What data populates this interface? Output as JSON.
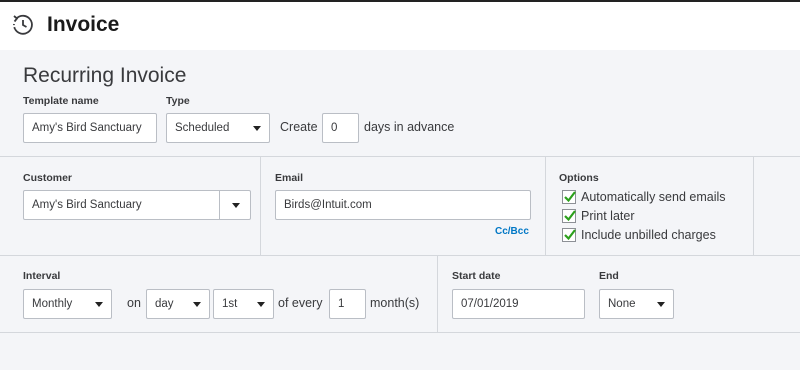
{
  "header": {
    "title": "Invoice",
    "icon": "recurring-icon"
  },
  "section_title": "Recurring Invoice",
  "template": {
    "name_label": "Template name",
    "name_value": "Amy's Bird Sanctuary",
    "type_label": "Type",
    "type_value": "Scheduled",
    "create_label": "Create",
    "create_value": "0",
    "days_suffix": "days in advance"
  },
  "customer": {
    "label": "Customer",
    "value": "Amy's Bird Sanctuary"
  },
  "email": {
    "label": "Email",
    "value": "Birds@Intuit.com",
    "ccbcc": "Cc/Bcc"
  },
  "options": {
    "label": "Options",
    "items": [
      {
        "label": "Automatically send emails",
        "checked": true
      },
      {
        "label": "Print later",
        "checked": true
      },
      {
        "label": "Include unbilled charges",
        "checked": true
      }
    ]
  },
  "schedule": {
    "interval_label": "Interval",
    "interval_value": "Monthly",
    "on_label": "on",
    "day_value": "day",
    "ordinal_value": "1st",
    "of_every_label": "of every",
    "every_value": "1",
    "months_label": "month(s)",
    "start_label": "Start date",
    "start_value": "07/01/2019",
    "end_label": "End",
    "end_value": "None"
  },
  "colors": {
    "link": "#0077c5",
    "check": "#2ca01c",
    "border": "#babec5"
  }
}
